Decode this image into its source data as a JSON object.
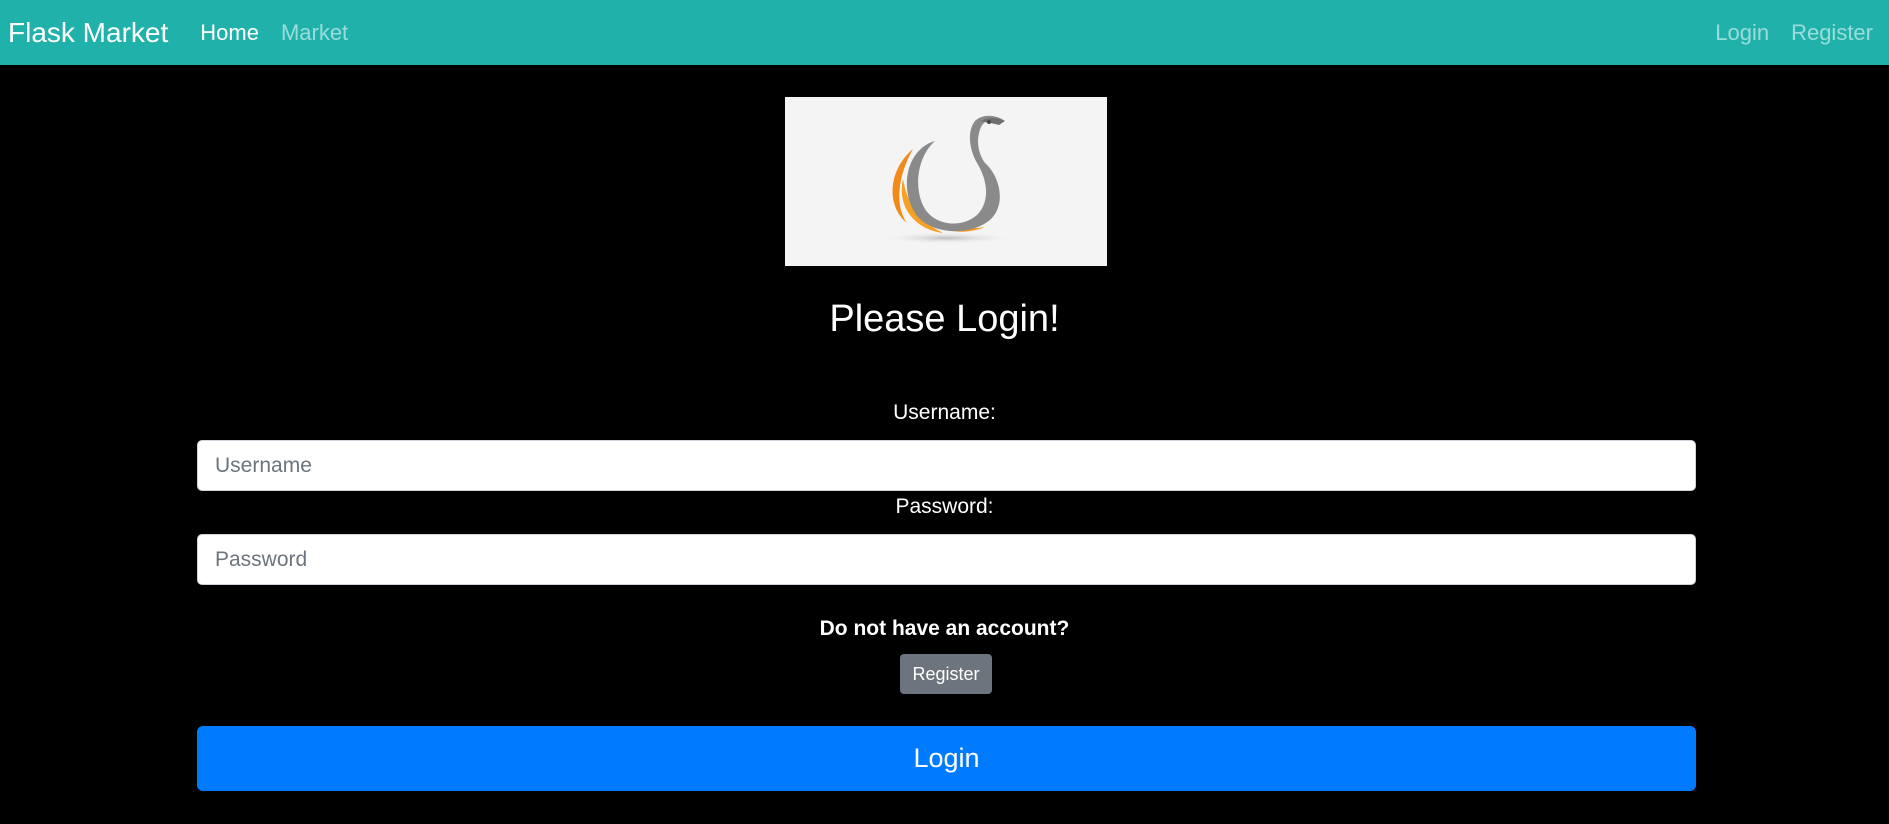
{
  "navbar": {
    "brand": "Flask Market",
    "left_links": [
      {
        "label": "Home",
        "active": true
      },
      {
        "label": "Market",
        "active": false
      }
    ],
    "right_links": [
      {
        "label": "Login"
      },
      {
        "label": "Register"
      }
    ],
    "background_color": "#20b2aa"
  },
  "logo": {
    "icon": "swan-logo-icon"
  },
  "form": {
    "heading": "Please Login!",
    "username_label": "Username:",
    "username_placeholder": "Username",
    "username_value": "",
    "password_label": "Password:",
    "password_placeholder": "Password",
    "password_value": "",
    "no_account_text": "Do not have an account?",
    "register_button": "Register",
    "login_button": "Login"
  },
  "colors": {
    "page_background": "#000000",
    "primary": "#007bff",
    "secondary": "#6c757d"
  }
}
